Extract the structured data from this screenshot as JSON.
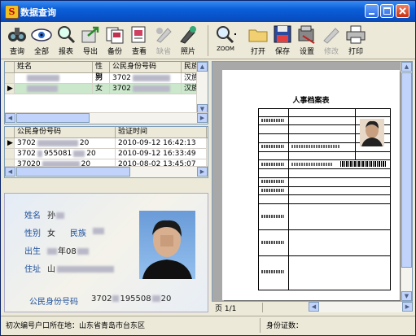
{
  "window": {
    "title": "数据查询",
    "app_icon_glyph": "S"
  },
  "toolbar_left": [
    {
      "label": "查询",
      "icon": "binoculars-icon",
      "enabled": true
    },
    {
      "label": "全部",
      "icon": "eye-icon",
      "enabled": true
    },
    {
      "label": "报表",
      "icon": "magnifier-icon",
      "enabled": true
    },
    {
      "label": "导出",
      "icon": "export-icon",
      "enabled": true
    },
    {
      "label": "备份",
      "icon": "backup-icon",
      "enabled": true
    },
    {
      "label": "查看",
      "icon": "view-icon",
      "enabled": true
    },
    {
      "label": "缺省",
      "icon": "default-icon",
      "enabled": false
    },
    {
      "label": "照片",
      "icon": "photo-icon",
      "enabled": true
    }
  ],
  "toolbar_right": [
    {
      "label": "ZOOM",
      "icon": "zoom-icon",
      "enabled": true
    },
    {
      "label": "打开",
      "icon": "folder-open-icon",
      "enabled": true
    },
    {
      "label": "保存",
      "icon": "floppy-icon",
      "enabled": true
    },
    {
      "label": "设置",
      "icon": "settings-icon",
      "enabled": true
    },
    {
      "label": "修改",
      "icon": "edit-icon",
      "enabled": false
    },
    {
      "label": "打印",
      "icon": "printer-icon",
      "enabled": true
    }
  ],
  "grid1": {
    "headers": [
      "姓名",
      "性别",
      "公民身份号码",
      "民族"
    ],
    "rows": [
      {
        "name": "",
        "gender": "男",
        "id": "3702",
        "ethnic": "汉族",
        "selected": false
      },
      {
        "name": "",
        "gender": "女",
        "id": "3702",
        "ethnic": "汉族",
        "selected": true
      }
    ]
  },
  "grid2": {
    "headers": [
      "公民身份号码",
      "验证时间"
    ],
    "rows": [
      {
        "id": "3702",
        "id_tail": "20",
        "time": "2010-09-12 16:42:13",
        "current": true
      },
      {
        "id": "3702",
        "id_tail": "955081",
        "id_end": "20",
        "time": "2010-09-12 16:33:49",
        "current": false
      },
      {
        "id": "37020",
        "id_tail": "20",
        "time": "2010-08-02 13:45:07",
        "current": false
      }
    ]
  },
  "id_card": {
    "name_label": "姓名",
    "name_value": "孙",
    "gender_label": "性别",
    "gender_value": "女",
    "ethnic_label": "民族",
    "birth_label": "出生",
    "birth_value": "年08",
    "address_label": "住址",
    "address_value": "山",
    "id_label": "公民身份号码",
    "id_value": "3702",
    "id_mid": "195508",
    "id_end": "20"
  },
  "preview": {
    "doc_title": "人事档案表",
    "page_label": "页 1/1"
  },
  "status": {
    "left": "初次编号户口所在地：山东省青岛市台东区",
    "right": "身份证数："
  },
  "colors": {
    "title_bar": "#0a5fd8",
    "id_label": "#1d4f9c",
    "selected_row": "#cce8cc"
  }
}
